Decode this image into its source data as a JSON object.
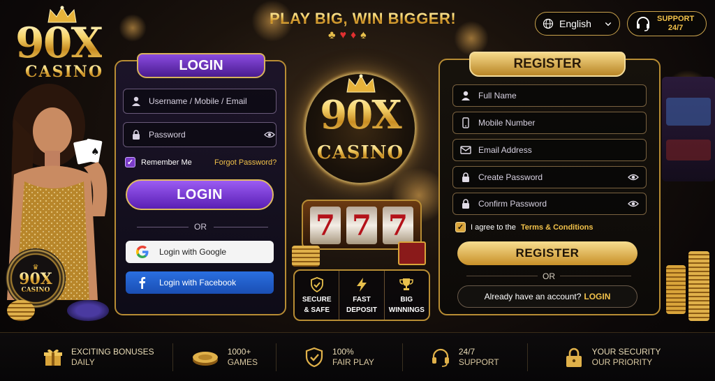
{
  "brand": {
    "logo_main": "90X",
    "logo_sub": "CASINO"
  },
  "header": {
    "tagline": "PLAY BIG, WIN BIGGER!",
    "suits": "♣♥♦♠",
    "language": "English",
    "support_line1": "SUPPORT",
    "support_line2": "24/7"
  },
  "login": {
    "tab_label": "LOGIN",
    "username_placeholder": "Username / Mobile / Email",
    "password_placeholder": "Password",
    "remember_label": "Remember Me",
    "forgot_label": "Forgot Password?",
    "button_label": "LOGIN",
    "or_label": "OR",
    "google_label": "Login with Google",
    "facebook_label": "Login with Facebook"
  },
  "center": {
    "logo_main": "90X",
    "logo_sub": "CASINO",
    "reels": [
      "7",
      "7",
      "7"
    ],
    "features": [
      {
        "icon": "shield-check-icon",
        "line1": "SECURE",
        "line2": "& SAFE"
      },
      {
        "icon": "lightning-icon",
        "line1": "FAST",
        "line2": "DEPOSIT"
      },
      {
        "icon": "trophy-icon",
        "line1": "BIG",
        "line2": "WINNINGS"
      }
    ]
  },
  "register": {
    "tab_label": "REGISTER",
    "fullname_placeholder": "Full Name",
    "mobile_placeholder": "Mobile Number",
    "email_placeholder": "Email Address",
    "create_password_placeholder": "Create Password",
    "confirm_password_placeholder": "Confirm Password",
    "agree_prefix": "I agree to the",
    "agree_link": "Terms & Conditions",
    "button_label": "REGISTER",
    "or_label": "OR",
    "have_account": "Already have an account?",
    "login_link": "LOGIN"
  },
  "chip_logo": {
    "main": "90X",
    "sub": "CASINO"
  },
  "bottom_bar": [
    {
      "icon": "gift-icon",
      "line1": "EXCITING BONUSES",
      "line2": "DAILY"
    },
    {
      "icon": "chips-icon",
      "line1": "1000+",
      "line2": "GAMES"
    },
    {
      "icon": "shield-check-icon",
      "line1": "100%",
      "line2": "FAIR PLAY"
    },
    {
      "icon": "headset-icon",
      "line1": "24/7",
      "line2": "SUPPORT"
    },
    {
      "icon": "lock-icon",
      "line1": "YOUR SECURITY",
      "line2": "OUR PRIORITY"
    }
  ],
  "colors": {
    "gold": "#f1c14a",
    "purple": "#6a2bd0",
    "facebook": "#1d5fd1"
  }
}
